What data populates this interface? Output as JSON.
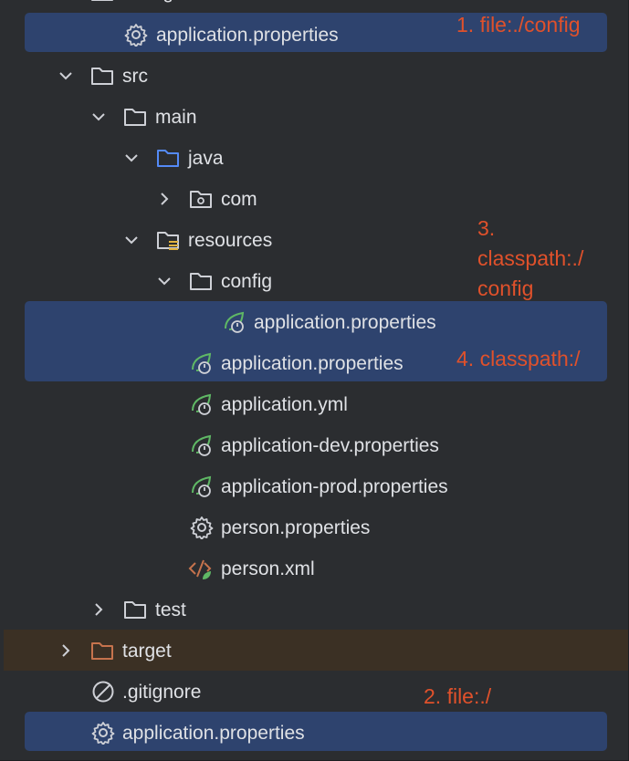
{
  "tree": {
    "top_partial_label": "config",
    "rows": {
      "root_config_props": "application.properties",
      "src": "src",
      "main": "main",
      "java": "java",
      "com": "com",
      "resources": "resources",
      "res_config": "config",
      "res_config_props": "application.properties",
      "res_props": "application.properties",
      "res_yml": "application.yml",
      "res_dev": "application-dev.properties",
      "res_prod": "application-prod.properties",
      "person_props": "person.properties",
      "person_xml": "person.xml",
      "test": "test",
      "target": "target",
      "gitignore": ".gitignore",
      "root_props": "application.properties"
    }
  },
  "annotations": {
    "a1": "1. file:./config",
    "a2": "2. file:./",
    "a3_line1": "3.",
    "a3_line2": "classpath:./",
    "a3_line3": "config",
    "a4": "4. classpath:/"
  },
  "colors": {
    "background": "#2b2d30",
    "selection": "#2e436e",
    "ignored_folder_row": "#3b3024",
    "annotation": "#e0512b",
    "text": "#dfe1e5",
    "icon_gray": "#ced0d6",
    "java_folder_blue": "#548af7",
    "spring_green": "#5fb865",
    "target_folder_orange": "#c6734d"
  },
  "icons": [
    "gear-icon",
    "folder-icon",
    "chevron-down-icon",
    "chevron-right-icon",
    "package-folder-icon",
    "resources-folder-icon",
    "spring-leaf-icon",
    "xml-icon",
    "ignore-icon"
  ]
}
